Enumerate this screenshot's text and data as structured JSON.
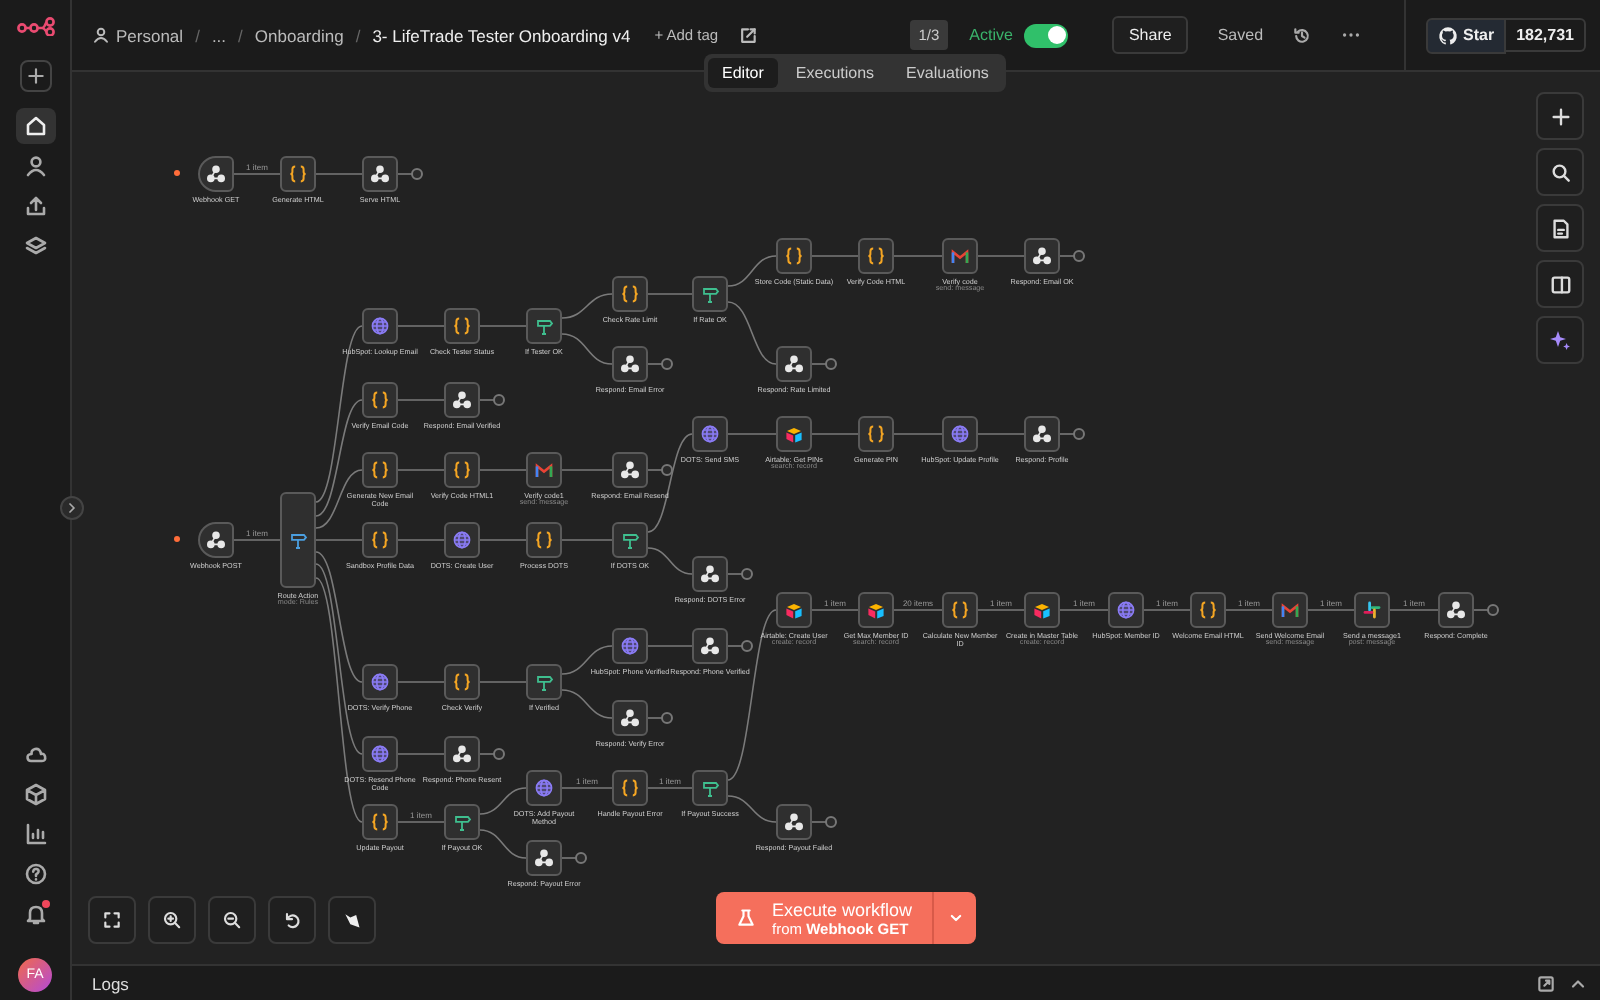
{
  "header": {
    "breadcrumbs": [
      {
        "text": "Personal",
        "kind": "project"
      },
      {
        "text": "...",
        "kind": "folder"
      },
      {
        "text": "Onboarding",
        "kind": "folder"
      },
      {
        "text": "3- LifeTrade Tester Onboarding v4",
        "kind": "workflow"
      }
    ],
    "separator": "/",
    "add_tag": "+ Add tag",
    "version_badge": "1/3",
    "active": {
      "label": "Active",
      "on": true
    },
    "share": "Share",
    "save_status": "Saved",
    "github": {
      "label": "Star",
      "count": "182,731"
    }
  },
  "view_tabs": [
    {
      "label": "Editor",
      "selected": true
    },
    {
      "label": "Executions",
      "selected": false
    },
    {
      "label": "Evaluations",
      "selected": false
    }
  ],
  "sidebar": {
    "nav": [
      {
        "kind": "home",
        "selected": true
      },
      {
        "kind": "person",
        "selected": false
      },
      {
        "kind": "share",
        "selected": false
      },
      {
        "kind": "layers",
        "selected": false
      }
    ],
    "notifications_unread": true,
    "avatar": "FA"
  },
  "canvas": {
    "nodes": [
      {
        "label": "Webhook GET",
        "kind": "trigger"
      },
      {
        "label": "Generate HTML",
        "kind": "code"
      },
      {
        "label": "Serve HTML",
        "kind": "respond"
      },
      {
        "label": "Webhook POST",
        "kind": "trigger"
      },
      {
        "label": "Route Action",
        "subtitle": "mode: Rules",
        "kind": "switch"
      },
      {
        "label": "HubSpot: Lookup Email",
        "kind": "http"
      },
      {
        "label": "Check Tester Status",
        "kind": "code"
      },
      {
        "label": "If Tester OK",
        "kind": "if"
      },
      {
        "label": "Check Rate Limit",
        "kind": "code"
      },
      {
        "label": "If Rate OK",
        "kind": "if"
      },
      {
        "label": "Store Code (Static Data)",
        "kind": "code"
      },
      {
        "label": "Verify Code HTML",
        "kind": "code"
      },
      {
        "label": "Verify code",
        "subtitle": "send: message",
        "kind": "gmail"
      },
      {
        "label": "Respond: Email OK",
        "kind": "respond"
      },
      {
        "label": "Respond: Email Error",
        "kind": "respond"
      },
      {
        "label": "Respond: Rate Limited",
        "kind": "respond"
      },
      {
        "label": "Verify Email Code",
        "kind": "code"
      },
      {
        "label": "Respond: Email Verified",
        "kind": "respond"
      },
      {
        "label": "Generate New Email Code",
        "kind": "code"
      },
      {
        "label": "Verify Code HTML1",
        "kind": "code"
      },
      {
        "label": "Verify code1",
        "subtitle": "send: message",
        "kind": "gmail"
      },
      {
        "label": "Respond: Email Resend",
        "kind": "respond"
      },
      {
        "label": "Sandbox Profile Data",
        "kind": "code"
      },
      {
        "label": "DOTS: Create User",
        "kind": "http"
      },
      {
        "label": "Process DOTS",
        "kind": "code"
      },
      {
        "label": "If DOTS OK",
        "kind": "if"
      },
      {
        "label": "DOTS: Send SMS",
        "kind": "http"
      },
      {
        "label": "Airtable: Get PINs",
        "subtitle": "search: record",
        "kind": "airtable"
      },
      {
        "label": "Generate PIN",
        "kind": "code"
      },
      {
        "label": "HubSpot: Update Profile",
        "kind": "http"
      },
      {
        "label": "Respond: Profile",
        "kind": "respond"
      },
      {
        "label": "Respond: DOTS Error",
        "kind": "respond"
      },
      {
        "label": "Airtable: Create User",
        "subtitle": "create: record",
        "kind": "airtable"
      },
      {
        "label": "Get Max Member ID",
        "subtitle": "search: record",
        "kind": "airtable"
      },
      {
        "label": "Calculate New Member ID",
        "kind": "code"
      },
      {
        "label": "Create in Master Table",
        "subtitle": "create: record",
        "kind": "airtable"
      },
      {
        "label": "HubSpot: Member ID",
        "kind": "http"
      },
      {
        "label": "Welcome Email HTML",
        "kind": "code"
      },
      {
        "label": "Send Welcome Email",
        "subtitle": "send: message",
        "kind": "gmail"
      },
      {
        "label": "Send a message1",
        "subtitle": "post: message",
        "kind": "slack"
      },
      {
        "label": "Respond: Complete",
        "kind": "respond"
      },
      {
        "label": "DOTS: Verify Phone",
        "kind": "http"
      },
      {
        "label": "Check Verify",
        "kind": "code"
      },
      {
        "label": "If Verified",
        "kind": "if"
      },
      {
        "label": "HubSpot: Phone Verified",
        "kind": "http"
      },
      {
        "label": "Respond: Phone Verified",
        "kind": "respond"
      },
      {
        "label": "Respond: Verify Error",
        "kind": "respond"
      },
      {
        "label": "DOTS: Resend Phone Code",
        "kind": "http"
      },
      {
        "label": "Respond: Phone Resent",
        "kind": "respond"
      },
      {
        "label": "Update Payout",
        "kind": "code"
      },
      {
        "label": "If Payout OK",
        "kind": "if"
      },
      {
        "label": "DOTS: Add Payout Method",
        "kind": "http"
      },
      {
        "label": "Handle Payout Error",
        "kind": "code"
      },
      {
        "label": "If Payout Success",
        "kind": "if"
      },
      {
        "label": "Respond: Payout Failed",
        "kind": "respond"
      },
      {
        "label": "Respond: Payout Error",
        "kind": "respond"
      }
    ],
    "edge_labels": [
      "1 item",
      "1 item",
      "1 item",
      "20 items",
      "1 item",
      "1 item",
      "1 item",
      "1 item",
      "1 item",
      "1 item",
      "1 item",
      "1 item",
      "1 item"
    ]
  },
  "execute_button": {
    "label": "Execute workflow",
    "source": "from **Webhook GET**"
  },
  "logs": {
    "title": "Logs"
  }
}
